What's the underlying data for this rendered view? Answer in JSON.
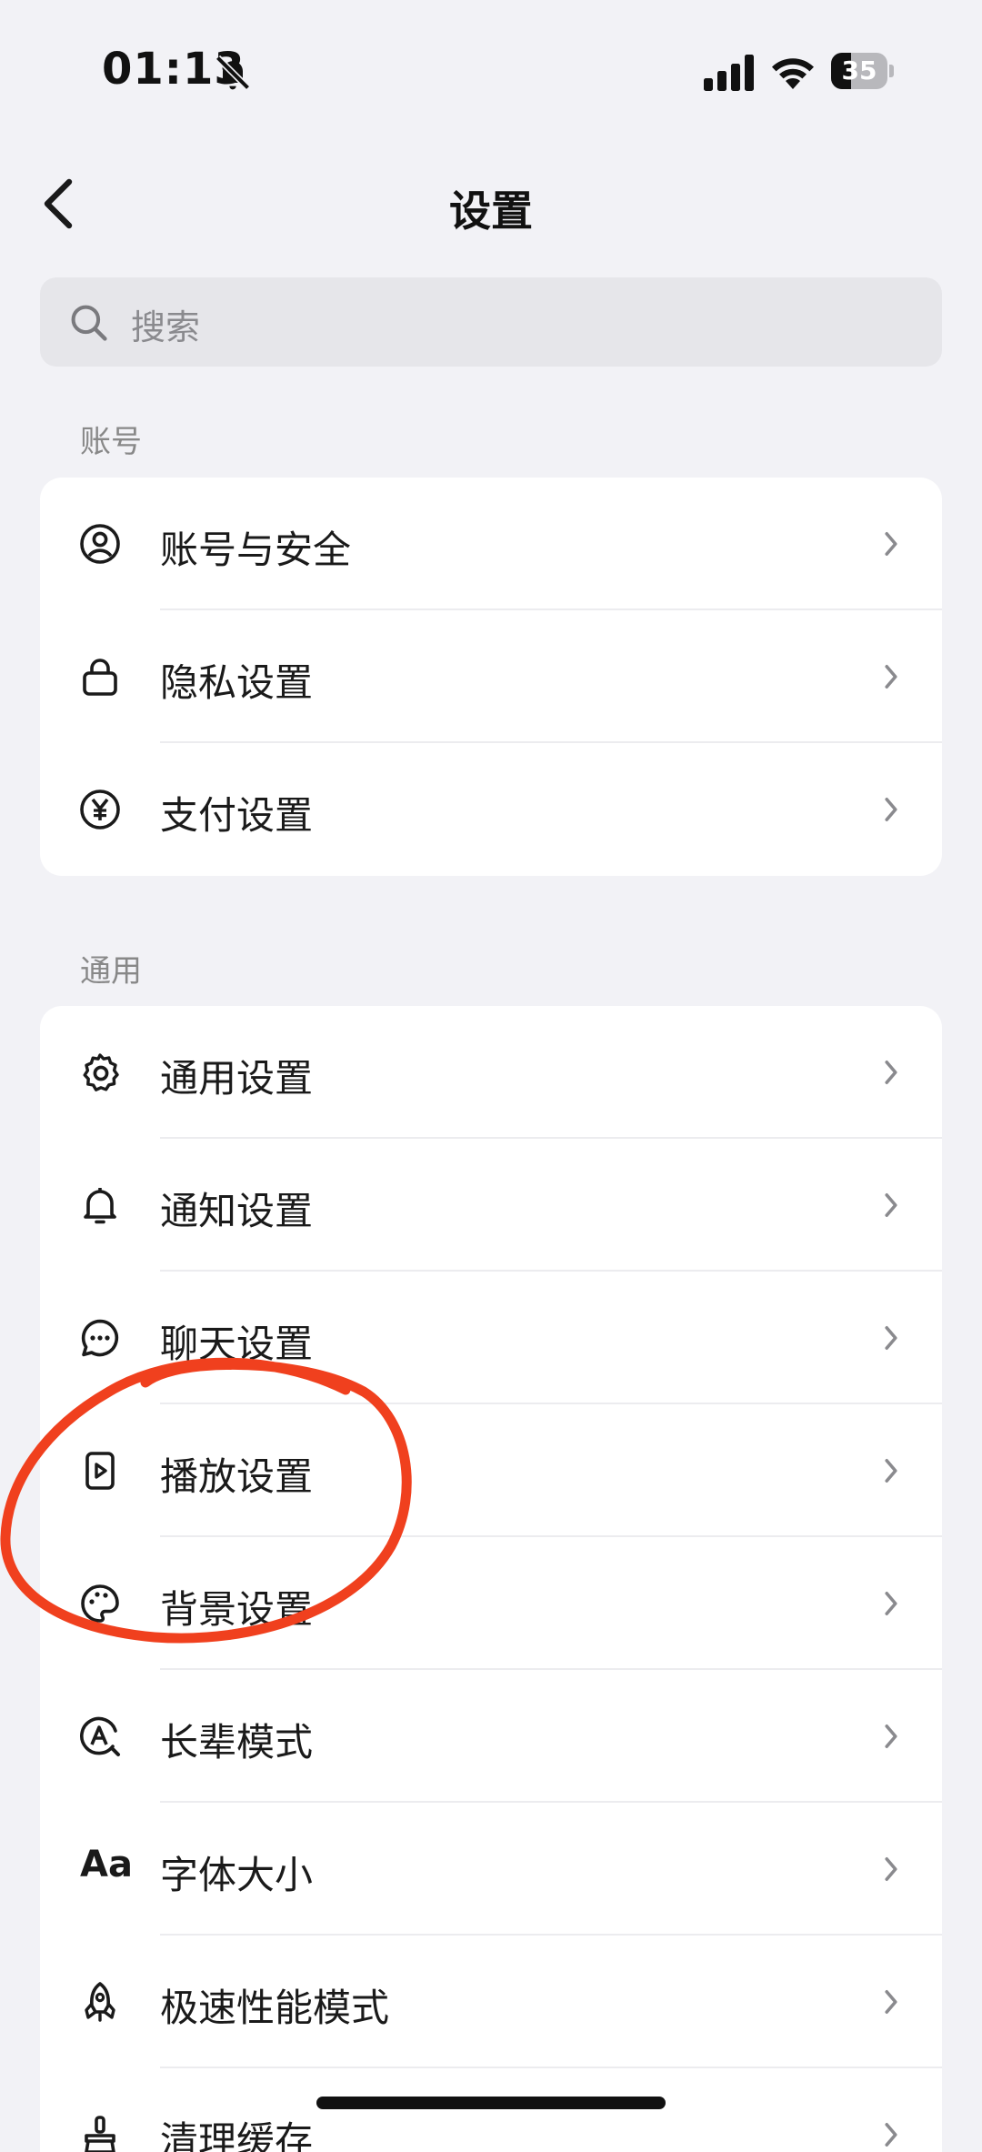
{
  "status_bar": {
    "time": "01:13",
    "battery_level": "35",
    "battery_fraction": 0.35
  },
  "header": {
    "title": "设置",
    "back_icon": "chevron-left-icon"
  },
  "search": {
    "placeholder": "搜索"
  },
  "sections": [
    {
      "label": "账号",
      "items": [
        {
          "label": "账号与安全",
          "icon": "user-circle-icon"
        },
        {
          "label": "隐私设置",
          "icon": "lock-icon"
        },
        {
          "label": "支付设置",
          "icon": "yuan-icon"
        }
      ]
    },
    {
      "label": "通用",
      "items": [
        {
          "label": "通用设置",
          "icon": "gear-icon"
        },
        {
          "label": "通知设置",
          "icon": "bell-icon"
        },
        {
          "label": "聊天设置",
          "icon": "chat-bubble-icon"
        },
        {
          "label": "播放设置",
          "icon": "play-icon"
        },
        {
          "label": "背景设置",
          "icon": "palette-icon"
        },
        {
          "label": "长辈模式",
          "icon": "elder-mode-icon"
        },
        {
          "label": "字体大小",
          "icon": "font-size-icon",
          "icon_text": "Aa"
        },
        {
          "label": "极速性能模式",
          "icon": "rocket-icon"
        },
        {
          "label": "清理缓存",
          "icon": "broom-icon"
        }
      ]
    }
  ],
  "annotation": {
    "color": "#f0401e",
    "shape": "freehand circle around 播放设置"
  }
}
